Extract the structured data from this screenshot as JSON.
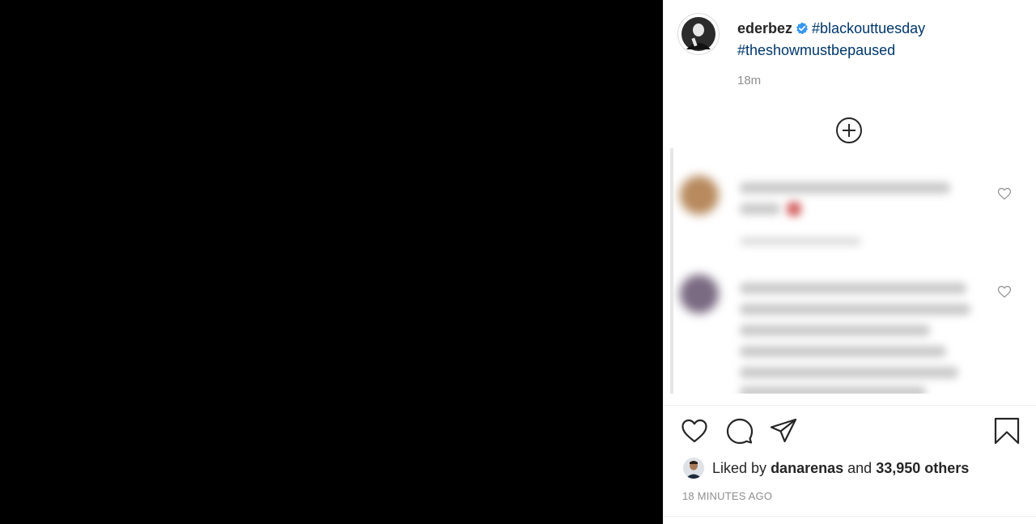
{
  "post": {
    "username": "ederbez",
    "verified": true,
    "hashtags": [
      "#blackouttuesday",
      "#theshowmustbepaused"
    ],
    "time_ago": "18m",
    "likes": {
      "prefix": "Liked by",
      "user": "danarenas",
      "connector": "and",
      "count": "33,950 others"
    },
    "timestamp": "18 MINUTES AGO"
  },
  "icons": {
    "load_more": "plus-circle-icon",
    "like": "heart-icon",
    "comment": "comment-icon",
    "share": "paper-plane-icon",
    "save": "bookmark-icon"
  },
  "colors": {
    "hashtag": "#00376b",
    "verified": "#3897f0",
    "muted": "#8e8e8e"
  }
}
